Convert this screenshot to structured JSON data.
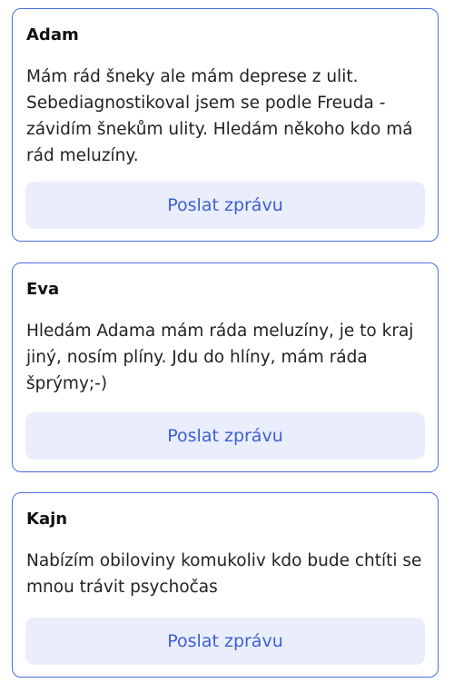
{
  "profiles": [
    {
      "name": "Adam",
      "text": "Mám rád šneky ale mám deprese z ulit. Sebediagnostikoval jsem se podle Freuda - závidím šnekům ulity. Hledám někoho kdo má rád meluzíny.",
      "button_label": "Poslat zprávu"
    },
    {
      "name": "Eva",
      "text": "Hledám Adama mám ráda meluzíny, je to kraj jiný, nosím plíny. Jdu do hlíny, mám ráda šprýmy;-)",
      "button_label": "Poslat zprávu"
    },
    {
      "name": "Kajn",
      "text": "Nabízím obiloviny komukoliv kdo bude chtíti se mnou trávit psychočas",
      "button_label": "Poslat zprávu"
    }
  ],
  "colors": {
    "card_border": "#4a6ee0",
    "button_background": "#eaeefc",
    "button_text": "#3b5fd6"
  }
}
